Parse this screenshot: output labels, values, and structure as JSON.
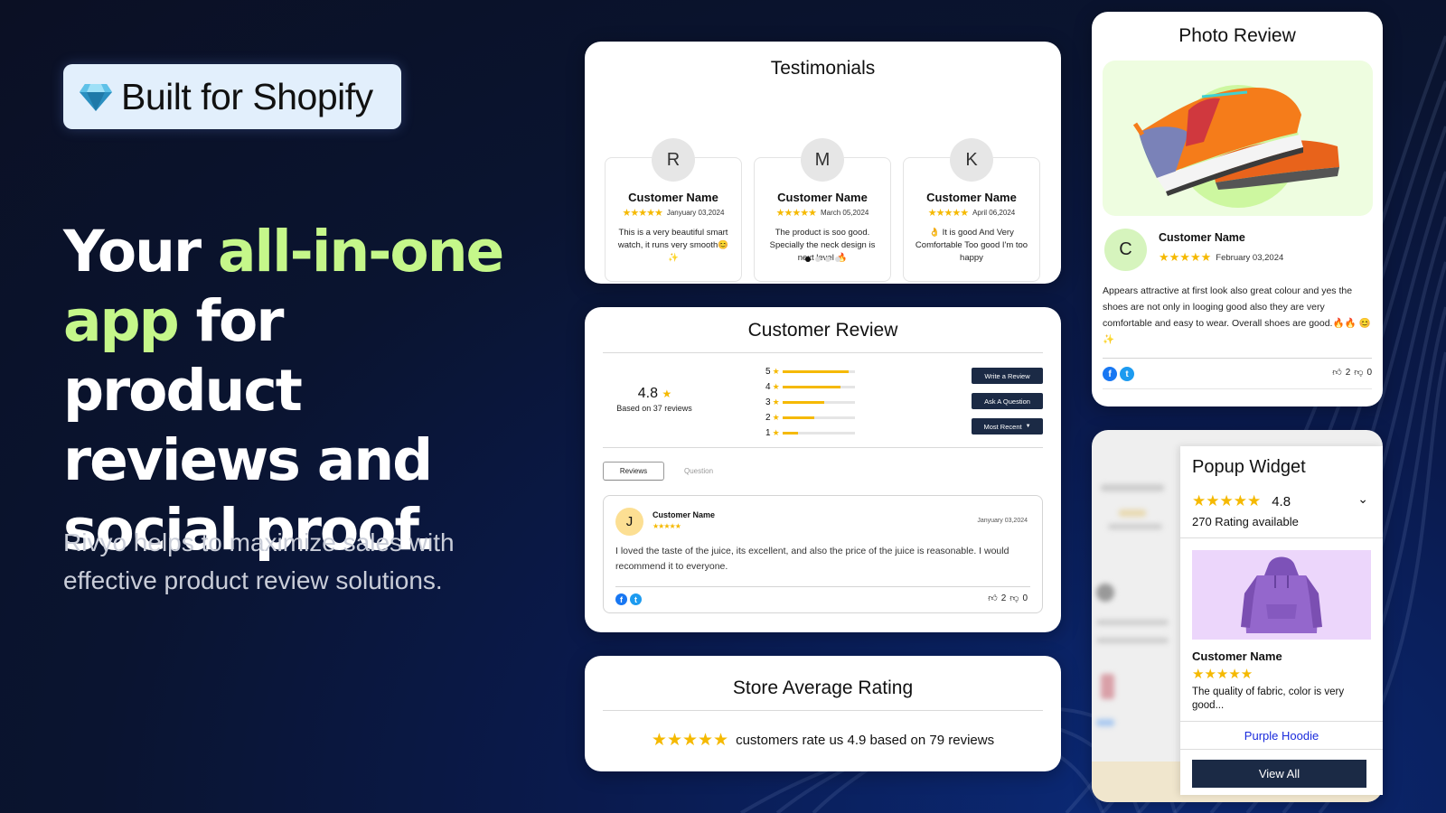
{
  "brand_badge": {
    "label": "Built for Shopify",
    "icon": "diamond-icon"
  },
  "hero": {
    "headline_parts": [
      {
        "text": "Your ",
        "accent": false
      },
      {
        "text": "all-in-one",
        "accent": true
      },
      {
        "text": " ",
        "accent": false
      },
      {
        "text": "app",
        "accent": true
      },
      {
        "text": " for product reviews and social proof.",
        "accent": false
      }
    ],
    "subtitle": "Rivyo helps to maximize sales with effective product review solutions."
  },
  "colors": {
    "accent": "#c5f78a",
    "star": "#f5b900",
    "button_dark": "#1b2a45",
    "link": "#1a2bdc"
  },
  "testimonials": {
    "title": "Testimonials",
    "items": [
      {
        "initial": "R",
        "name": "Customer Name",
        "stars": "★★★★★",
        "date": "Janyuary 03,2024",
        "text": "This is a very beautiful smart watch, it runs very smooth😊 ✨"
      },
      {
        "initial": "M",
        "name": "Customer Name",
        "stars": "★★★★★",
        "date": "March 05,2024",
        "text": "The product is soo good. Specially the neck design is next level 🔥"
      },
      {
        "initial": "K",
        "name": "Customer Name",
        "stars": "★★★★★",
        "date": "April 06,2024",
        "text": "👌 It is good And Very Comfortable Too good I'm too happy"
      }
    ],
    "pagination": {
      "total": 4,
      "active": 1
    }
  },
  "customer_review": {
    "title": "Customer Review",
    "average": "4.8",
    "star": "★",
    "based_on": "Based on 37 reviews",
    "distribution": [
      {
        "label": "5",
        "fraction": 0.92
      },
      {
        "label": "4",
        "fraction": 0.81
      },
      {
        "label": "3",
        "fraction": 0.58
      },
      {
        "label": "2",
        "fraction": 0.44
      },
      {
        "label": "1",
        "fraction": 0.22
      }
    ],
    "buttons": {
      "write": "Write a Review",
      "ask": "Ask A Question",
      "sort": "Most Recent"
    },
    "tabs": [
      {
        "label": "Reviews",
        "active": true
      },
      {
        "label": "Question",
        "active": false
      }
    ],
    "review": {
      "initial": "J",
      "name": "Customer Name",
      "stars": "★★★★★",
      "date": "Janyuary 03,2024",
      "text": "I loved the taste of the juice, its excellent, and also the price of the juice is reasonable. I would recommend it to everyone.",
      "likes": "2",
      "dislikes": "0"
    }
  },
  "store_average": {
    "title": "Store Average Rating",
    "stars": "★★★★★",
    "text": "customers rate us 4.9 based on 79 reviews"
  },
  "photo_review": {
    "title": "Photo Review",
    "image_alt": "orange running shoes",
    "initial": "C",
    "name": "Customer Name",
    "stars": "★★★★★",
    "date": "February 03,2024",
    "text": "Appears attractive at first look also great colour and yes the shoes are not only in looging good also they are very comfortable and easy to wear. Overall shoes are good.🔥🔥 😊 ✨",
    "likes": "2",
    "dislikes": "0"
  },
  "popup_widget": {
    "title": "Popup Widget",
    "stars": "★★★★★",
    "rating": "4.8",
    "count": "270 Rating available",
    "reviewer": "Customer Name",
    "review_stars": "★★★★★",
    "review_text": "The quality of fabric, color is very good...",
    "product_link": "Purple Hoodie",
    "view_all": "View All"
  }
}
